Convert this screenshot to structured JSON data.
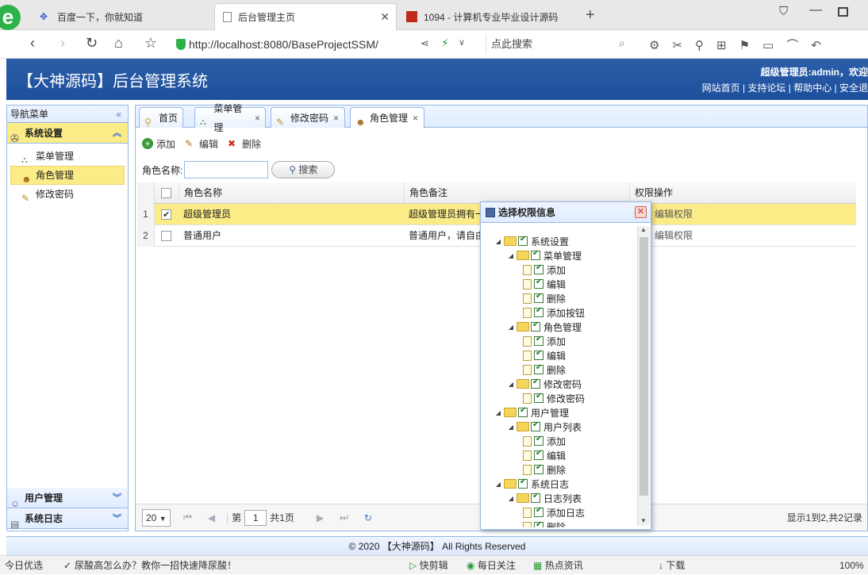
{
  "browser": {
    "tabs": [
      {
        "title": "百度一下，你就知道"
      },
      {
        "title": "后台管理主页"
      },
      {
        "title": "1094 - 计算机专业毕业设计源码"
      }
    ],
    "url": "http://localhost:8080/BaseProjectSSM/",
    "search_placeholder": "点此搜索"
  },
  "header": {
    "title": "【大神源码】后台管理系统",
    "user": "超级管理员:admin，欢迎",
    "links": "网站首页 | 支持论坛 | 帮助中心 | 安全退"
  },
  "sidebar": {
    "title": "导航菜单",
    "groups": [
      {
        "label": "系统设置"
      },
      {
        "label": "用户管理"
      },
      {
        "label": "系统日志"
      }
    ],
    "items": [
      {
        "label": "菜单管理"
      },
      {
        "label": "角色管理"
      },
      {
        "label": "修改密码"
      }
    ]
  },
  "tabs": [
    {
      "label": "首页"
    },
    {
      "label": "菜单管理"
    },
    {
      "label": "修改密码"
    },
    {
      "label": "角色管理"
    }
  ],
  "toolbar": {
    "add": "添加",
    "edit": "编辑",
    "delete": "删除"
  },
  "search": {
    "label": "角色名称:",
    "button": "搜索"
  },
  "grid": {
    "headers": [
      "角色名称",
      "角色备注",
      "权限操作"
    ],
    "rows": [
      {
        "num": "1",
        "name": "超级管理员",
        "remark": "超级管理员拥有一",
        "action": "编辑权限",
        "checked": true
      },
      {
        "num": "2",
        "name": "普通用户",
        "remark": "普通用户，请自由",
        "action": "编辑权限",
        "checked": false
      }
    ]
  },
  "pager": {
    "page_size": "20",
    "page_label": "第",
    "page": "1",
    "total_pages": "共1页",
    "summary": "显示1到2,共2记录"
  },
  "dialog": {
    "title": "选择权限信息",
    "tree": [
      {
        "label": "系统设置"
      },
      {
        "label": "菜单管理"
      },
      {
        "label": "添加"
      },
      {
        "label": "编辑"
      },
      {
        "label": "删除"
      },
      {
        "label": "添加按钮"
      },
      {
        "label": "角色管理"
      },
      {
        "label": "添加"
      },
      {
        "label": "编辑"
      },
      {
        "label": "删除"
      },
      {
        "label": "修改密码"
      },
      {
        "label": "修改密码"
      },
      {
        "label": "用户管理"
      },
      {
        "label": "用户列表"
      },
      {
        "label": "添加"
      },
      {
        "label": "编辑"
      },
      {
        "label": "删除"
      },
      {
        "label": "系统日志"
      },
      {
        "label": "日志列表"
      },
      {
        "label": "添加日志"
      },
      {
        "label": "删除"
      }
    ]
  },
  "footer": {
    "text": "© 2020 【大神源码】 All Rights Reserved"
  },
  "statusbar": {
    "left": "今日优选",
    "news": "尿酸高怎么办？教你一招快速降尿酸！",
    "items": [
      "快剪辑",
      "每日关注",
      "热点资讯",
      "下载"
    ],
    "zoom": "100%"
  }
}
